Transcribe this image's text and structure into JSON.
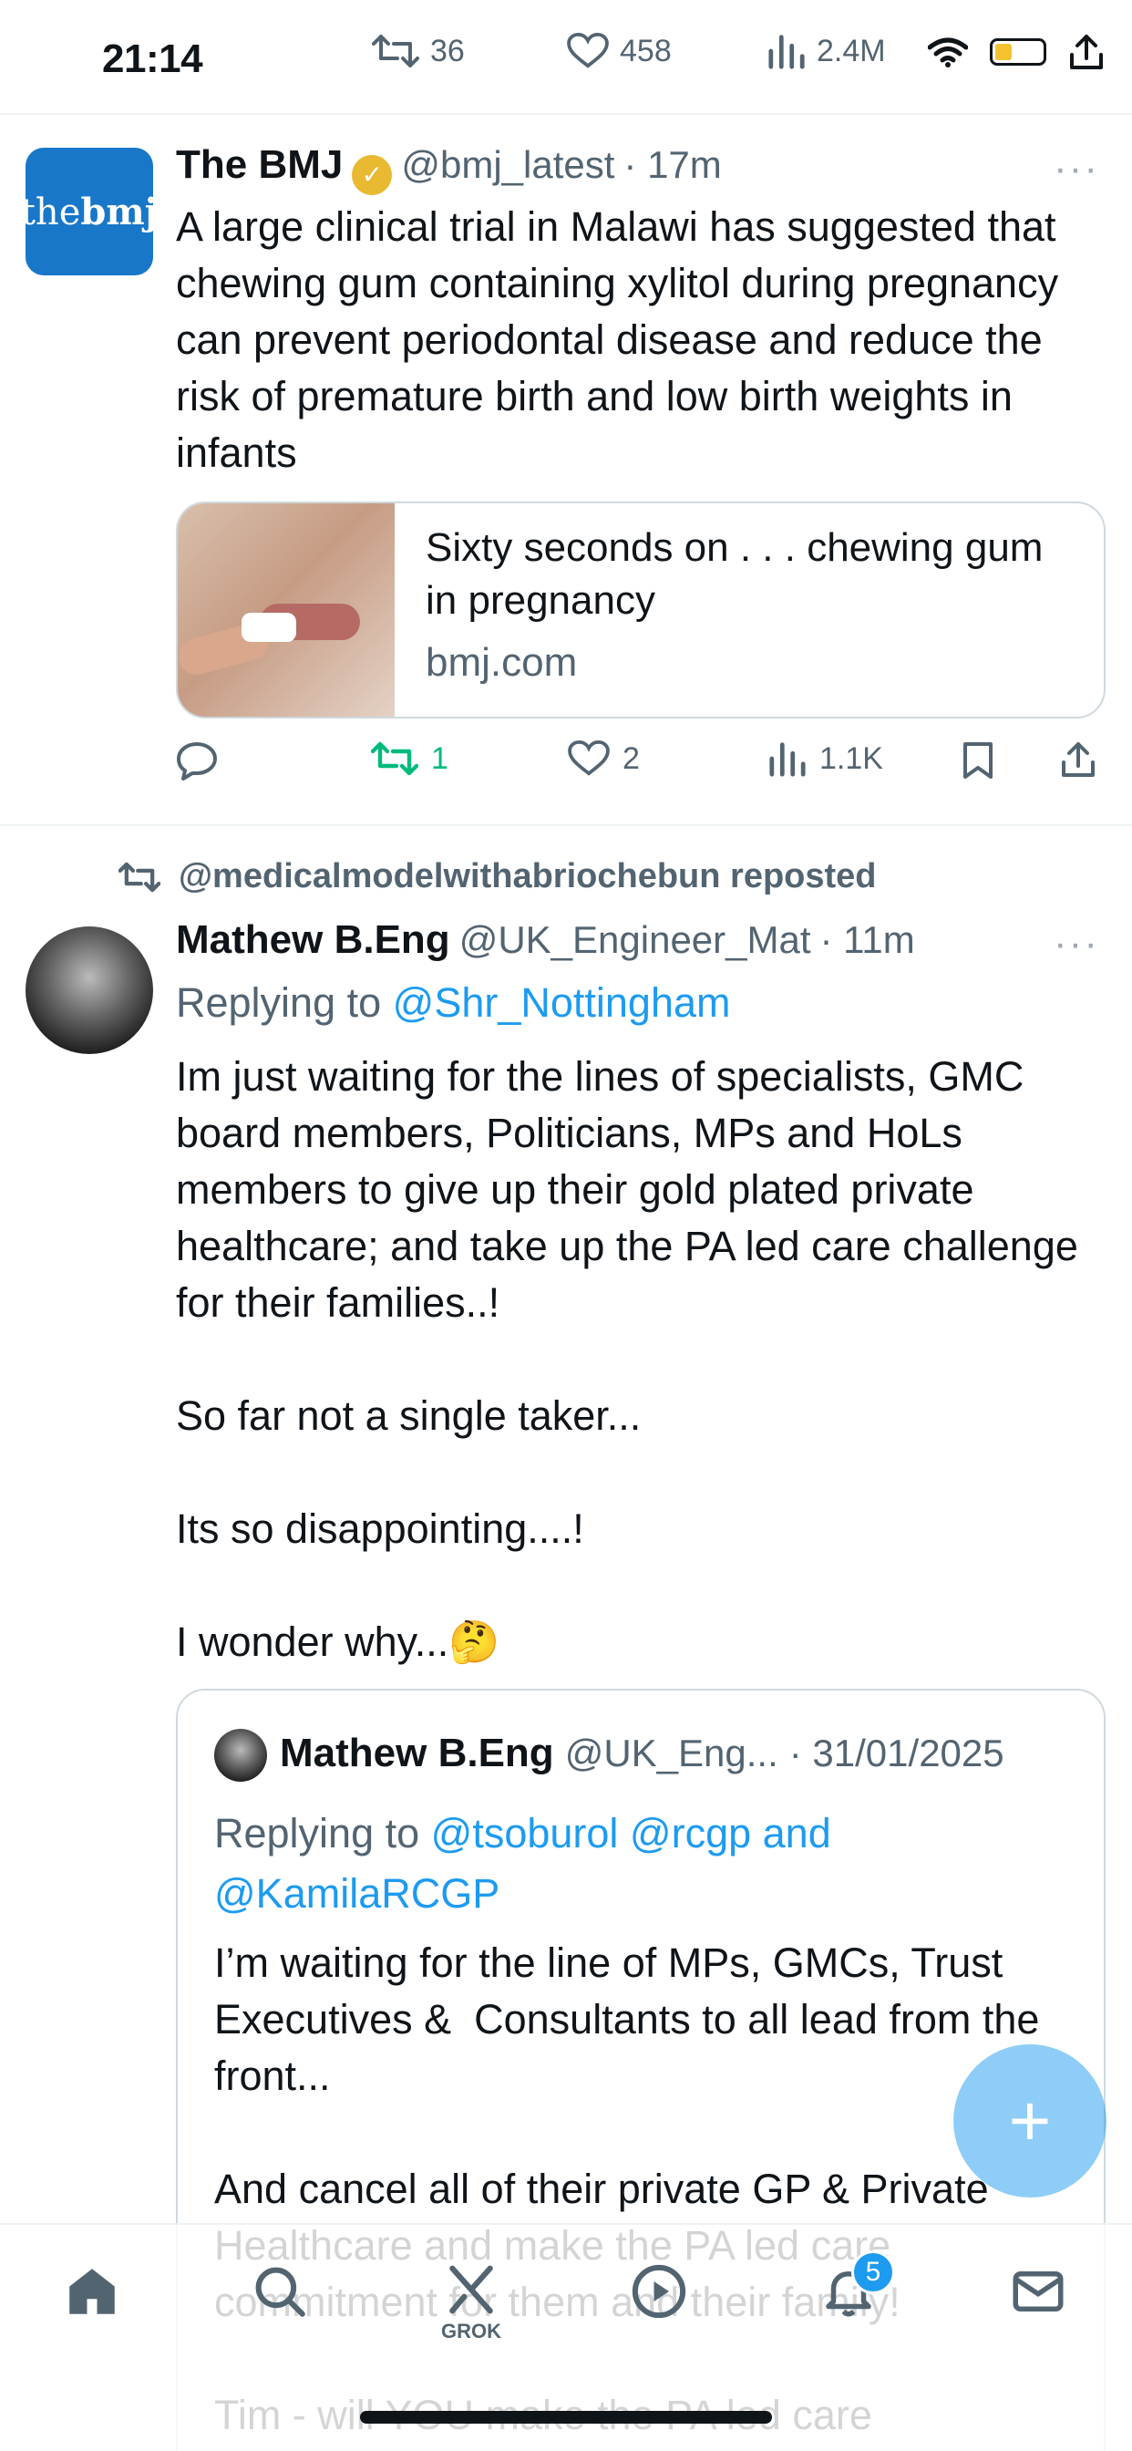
{
  "status_bar": {
    "time": "21:14",
    "retweets": "36",
    "likes": "458",
    "views": "2.4M"
  },
  "tweet1": {
    "author": "The BMJ",
    "avatar_text_plain": "the",
    "avatar_text_bold": "bmj",
    "handle": "@bmj_latest",
    "time": "· 17m",
    "text": "A large clinical trial in Malawi has suggested that chewing gum containing xylitol during pregnancy can prevent periodontal disease and reduce the risk of premature birth and low birth weights in infants",
    "card": {
      "title": "Sixty seconds on . . . chewing gum in pregnancy",
      "domain": "bmj.com"
    },
    "actions": {
      "retweets": "1",
      "likes": "2",
      "views": "1.1K"
    }
  },
  "repost_label": "@medicalmodelwithabriochebun reposted",
  "tweet2": {
    "author": "Mathew B.Eng",
    "handle": "@UK_Engineer_Mat",
    "time": "· 11m",
    "reply_prefix": "Replying to ",
    "reply_handle": "@Shr_Nottingham",
    "text": "Im just waiting for the lines of specialists, GMC board members, Politicians, MPs and HoLs members to give up their gold plated private healthcare; and take up the PA led care challenge for their families..!\n\nSo far not a single taker...\n\nIts so disappointing....!\n\nI wonder why...🤔",
    "quote": {
      "author": "Mathew B.Eng",
      "handle": "@UK_Eng...",
      "time": "· 31/01/2025",
      "reply_prefix": "Replying to ",
      "reply_handles_line1": "@tsoburol @rcgp and",
      "reply_handles_line2": "@KamilaRCGP",
      "text": "I’m waiting for the line of MPs, GMCs, Trust Executives &  Consultants to all lead from the front...\n\nAnd cancel all of their private GP & Private Healthcare and make the PA led care commitment for them and their family!\n\nTim - will YOU make the PA led care"
    }
  },
  "nav": {
    "grok_label": "GROK",
    "notifications_badge": "5"
  },
  "fab_label": "+",
  "more_label": "···"
}
